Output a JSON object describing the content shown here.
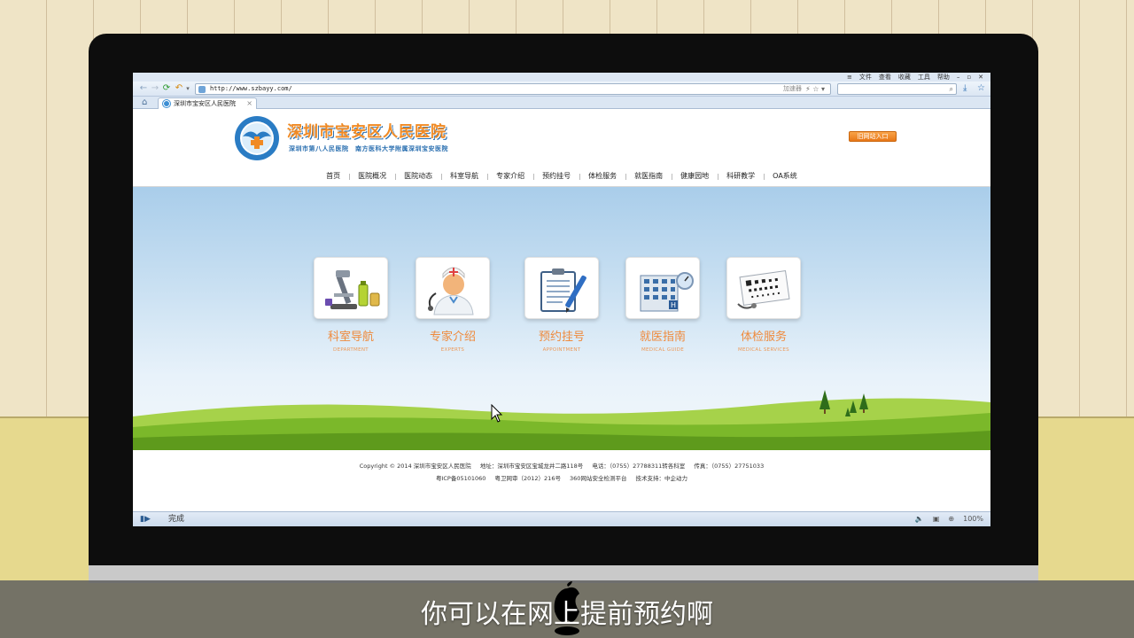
{
  "browser": {
    "menu": [
      "文件",
      "查看",
      "收藏",
      "工具",
      "帮助"
    ],
    "url": "http://www.szbayy.com/",
    "accelerate_label": "加速器",
    "tab_title": "深圳市宝安区人民医院",
    "status_text": "完成",
    "zoom": "100%"
  },
  "site": {
    "title": "深圳市宝安区人民医院",
    "subtitle": "深圳市第八人民医院　南方医科大学附属深圳宝安医院",
    "old_site_label": "旧网站入口",
    "nav": [
      "首页",
      "医院概况",
      "医院动态",
      "科室导航",
      "专家介绍",
      "预约挂号",
      "体检服务",
      "就医指南",
      "健康园地",
      "科研教学",
      "OA系统"
    ]
  },
  "cards": [
    {
      "title": "科室导航",
      "sub": "DEPARTMENT",
      "icon": "microscope-icon"
    },
    {
      "title": "专家介绍",
      "sub": "EXPERTS",
      "icon": "doctor-icon"
    },
    {
      "title": "预约挂号",
      "sub": "APPOINTMENT",
      "icon": "clipboard-pen-icon"
    },
    {
      "title": "就医指南",
      "sub": "MEDICAL GUIDE",
      "icon": "hospital-building-icon"
    },
    {
      "title": "体检服务",
      "sub": "MEDICAL SERVICES",
      "icon": "eye-chart-icon"
    }
  ],
  "footer": {
    "copyright": "Copyright © 2014  深圳市宝安区人民医院",
    "address": "地址：深圳市宝安区宝城龙井二路118号",
    "phone": "电话：（0755）27788311转各科室",
    "fax": "传真：（0755）27751033",
    "icp": "粤ICP备05101060",
    "license": "粤卫网审（2012）216号",
    "security": "360网站安全检测平台",
    "support": "技术支持：中企动力"
  },
  "caption": "你可以在网上提前预约啊",
  "colors": {
    "accent_orange": "#ef8a3c",
    "brand_blue": "#2a6fb0",
    "grass": "#7bb82a"
  }
}
